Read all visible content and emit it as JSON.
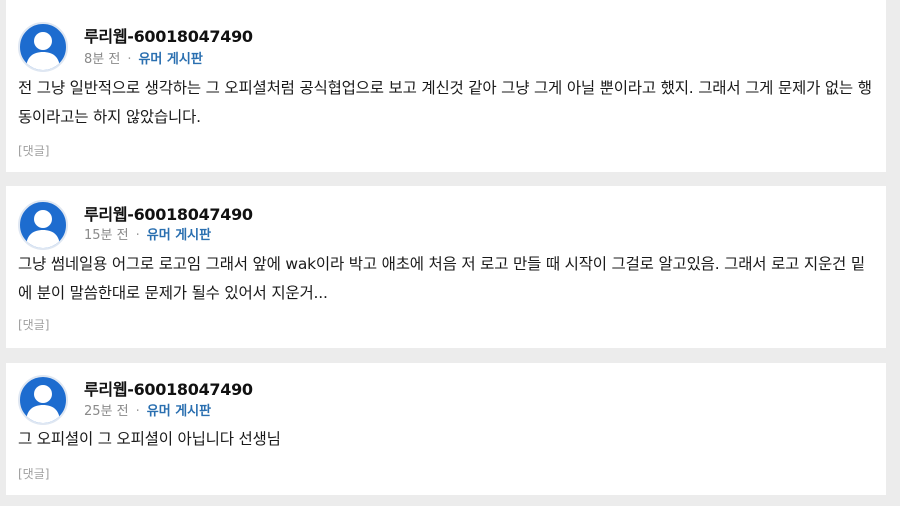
{
  "comments": [
    {
      "username": "루리웹-60018047490",
      "time": "8분 전",
      "separator": "·",
      "board": "유머 게시판",
      "text": "전 그냥 일반적으로 생각하는 그 오피셜처럼 공식협업으로 보고 계신것 같아 그냥 그게 아닐 뿐이라고 했지. 그래서 그게 문제가 없는 행동이라고는 하지 않았습니다.",
      "reply_label": "[댓글]",
      "avatar_icon": "user-avatar-icon"
    },
    {
      "username": "루리웹-60018047490",
      "time": "15분 전",
      "separator": "·",
      "board": "유머 게시판",
      "text": "그냥 썸네일용 어그로 로고임 그래서 앞에 wak이라 박고 애초에 처음 저 로고 만들 때 시작이 그걸로 알고있음. 그래서 로고 지운건 밑에 분이 말씀한대로 문제가 될수 있어서 지운거...",
      "reply_label": "[댓글]",
      "avatar_icon": "user-avatar-icon"
    },
    {
      "username": "루리웹-60018047490",
      "time": "25분 전",
      "separator": "·",
      "board": "유머 게시판",
      "text": "그 오피셜이 그 오피셜이 아닙니다 선생님",
      "reply_label": "[댓글]",
      "avatar_icon": "user-avatar-icon"
    }
  ],
  "colors": {
    "background": "#ececec",
    "card": "#ffffff",
    "avatar": "#1d6ccf",
    "board_link": "#2a6fb0",
    "meta_text": "#8a8a8a"
  }
}
